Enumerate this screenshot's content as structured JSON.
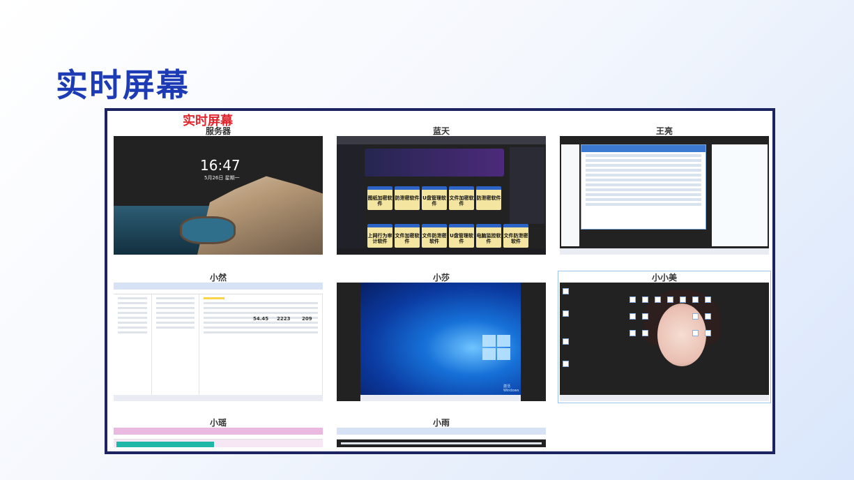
{
  "slide": {
    "title": "实时屏幕"
  },
  "frame": {
    "heading": "实时屏幕"
  },
  "screens": [
    {
      "name": "服务器",
      "lock_time": "16:47",
      "lock_date": "5月26日 星期一"
    },
    {
      "name": "蓝天",
      "tiles": [
        "图纸加密软件",
        "防泄密软件",
        "U盘管理软件",
        "文件加密软件",
        "防泄密软件",
        "上网行为审计软件",
        "文件加密软件",
        "文件防泄密软件",
        "U盘管理软件",
        "电脑监控软件",
        "文件防泄密软件"
      ]
    },
    {
      "name": "王亮"
    },
    {
      "name": "小然",
      "stats": [
        "54.45",
        "2223",
        "209"
      ]
    },
    {
      "name": "小莎",
      "activate": "激活 Windows"
    },
    {
      "name": "小小美"
    },
    {
      "name": "小瑶"
    },
    {
      "name": "小雨"
    }
  ]
}
